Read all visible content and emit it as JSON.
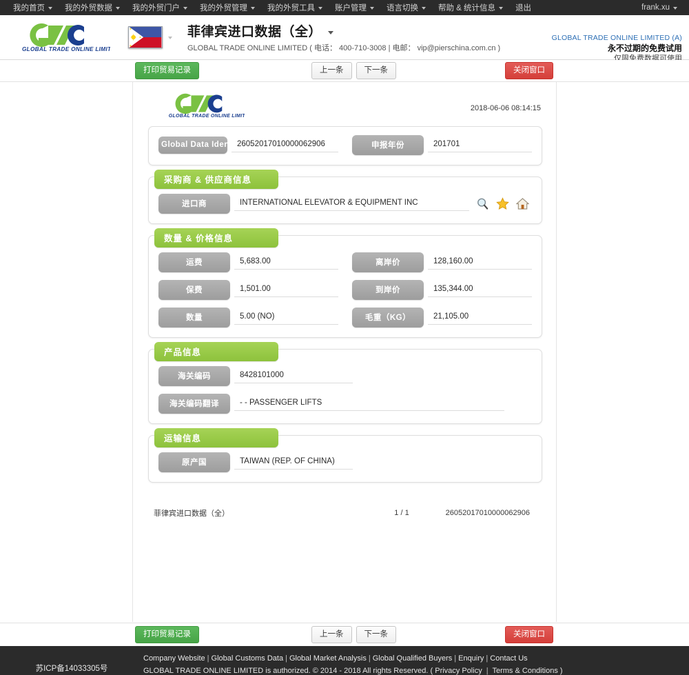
{
  "topnav": {
    "items": [
      {
        "label": "我的首页",
        "caret": true
      },
      {
        "label": "我的外贸数据",
        "caret": true
      },
      {
        "label": "我的外贸门户",
        "caret": true
      },
      {
        "label": "我的外贸管理",
        "caret": true
      },
      {
        "label": "我的外贸工具",
        "caret": true
      },
      {
        "label": "账户管理",
        "caret": true
      },
      {
        "label": "语言切换",
        "caret": true
      },
      {
        "label": "帮助 & 统计信息",
        "caret": true
      },
      {
        "label": "退出",
        "caret": false
      }
    ],
    "user": "frank.xu"
  },
  "header": {
    "logo_text": "GLOBAL TRADE ONLINE LIMITED",
    "flag": "philippines-flag",
    "title": "菲律宾进口数据（全）",
    "subtitle": "GLOBAL TRADE ONLINE LIMITED ( 电话： 400-710-3008 | 电邮： vip@pierschina.com.cn )",
    "account_name": "GLOBAL TRADE ONLINE LIMITED (A)",
    "account_trial": "永不过期的免费试用",
    "account_note": "仅限免费数据可使用"
  },
  "toolbar": {
    "print_label": "打印贸易记录",
    "prev_label": "上一条",
    "next_label": "下一条",
    "close_label": "关闭窗口"
  },
  "document": {
    "date": "2018-06-06 08:14:15",
    "identity_block": {
      "fields": [
        {
          "label": "Global Data Identity",
          "value": "26052017010000062906"
        },
        {
          "label": "申报年份",
          "value": "201701"
        }
      ]
    },
    "sections": [
      {
        "legend": "采购商 & 供应商信息",
        "rows": [
          {
            "label": "进口商",
            "value": "INTERNATIONAL ELEVATOR & EQUIPMENT INC",
            "icons": [
              "search-icon",
              "star-icon",
              "home-icon"
            ]
          }
        ]
      },
      {
        "legend": "数量 & 价格信息",
        "pairs": [
          {
            "left_label": "运费",
            "left_value": "5,683.00",
            "right_label": "离岸价",
            "right_value": "128,160.00"
          },
          {
            "left_label": "保费",
            "left_value": "1,501.00",
            "right_label": "到岸价",
            "right_value": "135,344.00"
          },
          {
            "left_label": "数量",
            "left_value": "5.00 (NO)",
            "right_label": "毛重（KG）",
            "right_value": "21,105.00"
          }
        ]
      },
      {
        "legend": "产品信息",
        "rows": [
          {
            "label": "海关编码",
            "value": "8428101000"
          },
          {
            "label": "海关编码翻译",
            "value": "- - PASSENGER LIFTS"
          }
        ]
      },
      {
        "legend": "运输信息",
        "rows": [
          {
            "label": "原产国",
            "value": "TAIWAN (REP. OF CHINA)"
          }
        ]
      }
    ],
    "footer": {
      "name": "菲律宾进口数据（全）",
      "page": "1 / 1",
      "identity": "26052017010000062906"
    }
  },
  "footer": {
    "icp": "苏ICP备14033305号",
    "links": [
      "Company Website",
      "Global Customs Data",
      "Global Market Analysis",
      "Global Qualified Buyers",
      "Enquiry",
      "Contact Us"
    ],
    "copyright_prefix": "GLOBAL TRADE ONLINE LIMITED is authorized. © 2014 - 2018 All rights Reserved.  (",
    "privacy": "Privacy Policy",
    "terms": "Terms & Conditions",
    "copyright_suffix": ")"
  },
  "colors": {
    "nav_bg": "#2b2b2b",
    "legend_green": "#9ccd4b",
    "label_gray": "#a8a8a8",
    "button_green": "#5cb85c",
    "button_red": "#d9534f",
    "accent_blue": "#2d6fb5"
  }
}
